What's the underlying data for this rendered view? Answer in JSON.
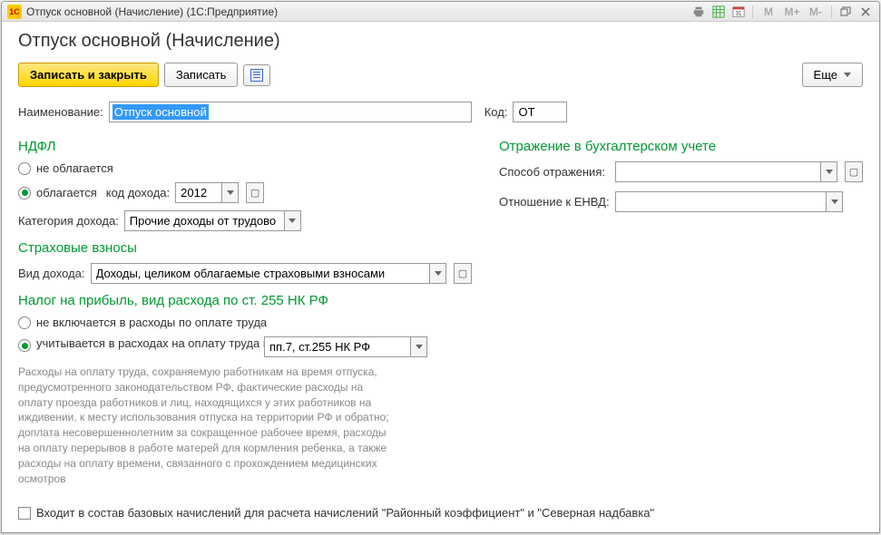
{
  "window": {
    "title": "Отпуск основной (Начисление) (1С:Предприятие)",
    "logo": "1С"
  },
  "page_title": "Отпуск основной (Начисление)",
  "toolbar": {
    "save_close": "Записать и закрыть",
    "save": "Записать",
    "more": "Еще"
  },
  "fields": {
    "name_label": "Наименование:",
    "name_value": "Отпуск основной",
    "code_label": "Код:",
    "code_value": "ОТ"
  },
  "ndfl": {
    "title": "НДФЛ",
    "not_taxed": "не облагается",
    "taxed": "облагается",
    "code_label": "код дохода:",
    "code_value": "2012",
    "category_label": "Категория дохода:",
    "category_value": "Прочие доходы от трудово"
  },
  "insurance": {
    "title": "Страховые взносы",
    "kind_label": "Вид дохода:",
    "kind_value": "Доходы, целиком облагаемые страховыми взносами"
  },
  "profit_tax": {
    "title": "Налог на прибыль, вид расхода по ст. 255 НК РФ",
    "not_included": "не включается в расходы по оплате труда",
    "included": "учитывается в расходах на оплату труда по статье:",
    "article_value": "пп.7, ст.255 НК РФ",
    "description": "Расходы на оплату труда, сохраняемую работникам на время отпуска, предусмотренного законодательством РФ, фактические расходы на оплату проезда работников и лиц, находящихся у этих работников на иждивении, к месту использования отпуска на территории РФ и обратно; доплата несовершеннолетним за сокращенное рабочее время, расходы на оплату перерывов в работе матерей для кормления ребенка, а также расходы на оплату времени, связанного с прохождением медицинских осмотров"
  },
  "accounting": {
    "title": "Отражение в бухгалтерском учете",
    "method_label": "Способ отражения:",
    "envd_label": "Отношение к ЕНВД:"
  },
  "footer": {
    "base_checkbox": "Входит в состав базовых начислений для расчета начислений \"Районный коэффициент\" и \"Северная надбавка\""
  }
}
